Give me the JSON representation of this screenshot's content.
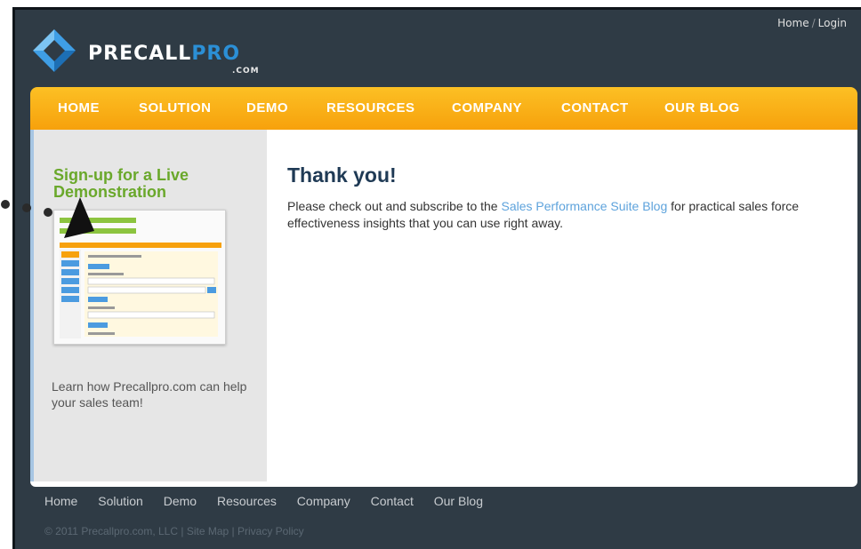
{
  "header": {
    "logo_main": "PRECALL",
    "logo_accent": "PRO",
    "logo_sub": ".COM",
    "top_links": [
      "Home",
      "Login"
    ],
    "top_link_separator": "/"
  },
  "nav": {
    "items": [
      "HOME",
      "SOLUTION",
      "DEMO",
      "RESOURCES",
      "COMPANY",
      "CONTACT",
      "OUR BLOG"
    ]
  },
  "sidebar": {
    "title": "Sign-up for a Live Demonstration",
    "learn_text": "Learn how Precallpro.com can help your sales team!"
  },
  "main": {
    "title": "Thank you!",
    "text_before": "Please check out and subscribe to the ",
    "link_text": "Sales Performance Suite Blog",
    "text_after": " for practical sales force effectiveness insights that you can use right away."
  },
  "footer": {
    "nav": [
      "Home",
      "Solution",
      "Demo",
      "Resources",
      "Company",
      "Contact",
      "Our Blog"
    ],
    "copyright": "© 2011 Precallpro.com, LLC",
    "sep": " | ",
    "sitemap": "Site Map",
    "privacy": "Privacy Policy"
  },
  "colors": {
    "header_bg": "#2f3b45",
    "nav_orange": "#f7a10c",
    "accent_green": "#6aa82b",
    "link_blue": "#5ea3dc",
    "title_navy": "#1f3a55"
  },
  "icons": [
    "precallpro-logo-icon",
    "cursor-arrow-icon"
  ]
}
